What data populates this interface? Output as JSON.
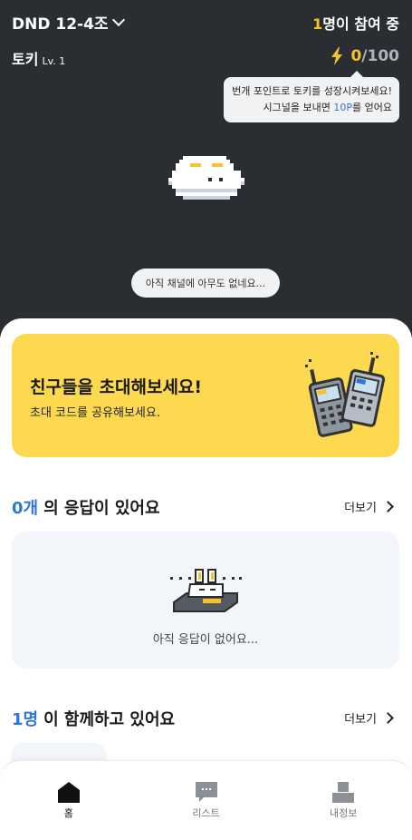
{
  "header": {
    "channel_name": "DND 12-4조",
    "participants_count": "1",
    "participants_suffix": "명이 참여 중",
    "pet_name": "토키",
    "pet_level": "Lv. 1",
    "points_current": "0",
    "points_separator": "/",
    "points_max": "100",
    "tooltip_line1": "번개 포인트로 토키를 성장시켜보세요!",
    "tooltip_line2_pre": "시그널을 보내면 ",
    "tooltip_line2_accent": "10P",
    "tooltip_line2_post": "를 얻어요",
    "empty_channel_message": "아직 채널에 아무도 없네요..."
  },
  "invite": {
    "title": "친구들을 초대해보세요!",
    "subtitle": "초대 코드를 공유해보세요."
  },
  "answers": {
    "count": "0개",
    "title": "의 응답이 있어요",
    "more_label": "더보기",
    "empty_message": "아직 응답이 없어요..."
  },
  "members": {
    "count": "1명",
    "title": "이 함께하고 있어요",
    "more_label": "더보기"
  },
  "bottom_nav": {
    "items": [
      {
        "label": "홈",
        "icon": "home-icon",
        "active": true
      },
      {
        "label": "리스트",
        "icon": "chat-list-icon",
        "active": false
      },
      {
        "label": "내정보",
        "icon": "profile-icon",
        "active": false
      }
    ]
  },
  "colors": {
    "hero_bg": "#2a2d31",
    "accent_yellow": "#f7c12d",
    "accent_blue": "#2f74d8",
    "invite_bg": "#fcd94e",
    "card_bg": "#f2f5f9"
  }
}
